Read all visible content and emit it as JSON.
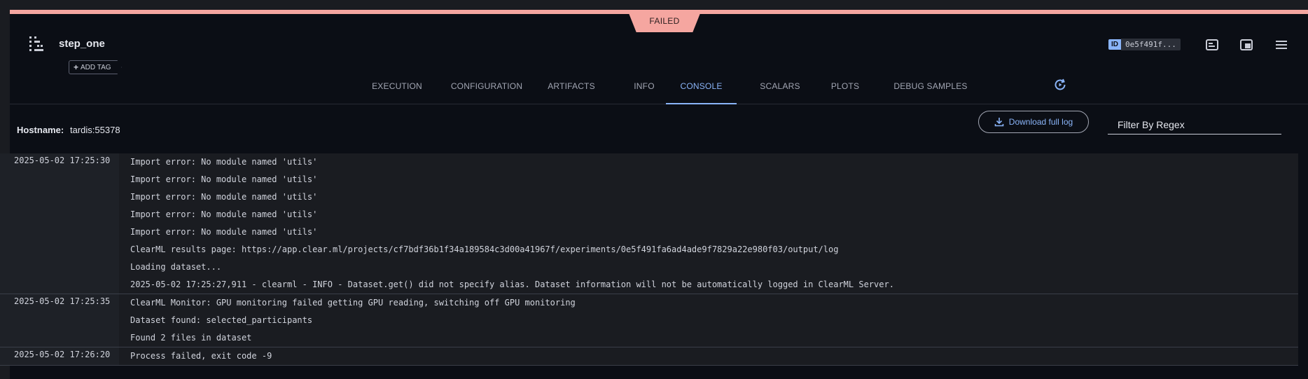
{
  "status": {
    "label": "FAILED"
  },
  "task": {
    "name": "step_one",
    "add_tag_label": "ADD TAG"
  },
  "id_badge": {
    "label": "ID",
    "value": "0e5f491f..."
  },
  "tabs": [
    {
      "label": "EXECUTION",
      "active": false
    },
    {
      "label": "CONFIGURATION",
      "active": false
    },
    {
      "label": "ARTIFACTS",
      "active": false
    },
    {
      "label": "INFO",
      "active": false
    },
    {
      "label": "CONSOLE",
      "active": true
    },
    {
      "label": "SCALARS",
      "active": false
    },
    {
      "label": "PLOTS",
      "active": false
    },
    {
      "label": "DEBUG SAMPLES",
      "active": false
    }
  ],
  "console": {
    "hostname_label": "Hostname:",
    "hostname_value": "tardis:55378",
    "download_label": "Download full log",
    "filter_placeholder": "Filter By Regex"
  },
  "log": [
    {
      "time": "2025-05-02 17:25:30",
      "lines": [
        "Import error: No module named 'utils'",
        "Import error: No module named 'utils'",
        "Import error: No module named 'utils'",
        "Import error: No module named 'utils'",
        "Import error: No module named 'utils'",
        "ClearML results page: https://app.clear.ml/projects/cf7bdf36b1f34a189584c3d00a41967f/experiments/0e5f491fa6ad4ade9f7829a22e980f03/output/log",
        "Loading dataset...",
        "2025-05-02 17:25:27,911 - clearml - INFO - Dataset.get() did not specify alias. Dataset information will not be automatically logged in ClearML Server."
      ]
    },
    {
      "time": "2025-05-02 17:25:35",
      "lines": [
        "ClearML Monitor: GPU monitoring failed getting GPU reading, switching off GPU monitoring",
        "Dataset found: selected_participants",
        "Found 2 files in dataset"
      ]
    },
    {
      "time": "2025-05-02 17:26:20",
      "lines": [
        "Process failed, exit code -9"
      ]
    }
  ],
  "colors": {
    "accent": "#8ab4f8",
    "failed": "#f5a6a0",
    "background": "#0b0e15"
  },
  "icons": [
    "pipeline-step-icon",
    "info-panel-icon",
    "split-view-icon",
    "menu-icon",
    "auto-refresh-icon",
    "download-icon"
  ]
}
